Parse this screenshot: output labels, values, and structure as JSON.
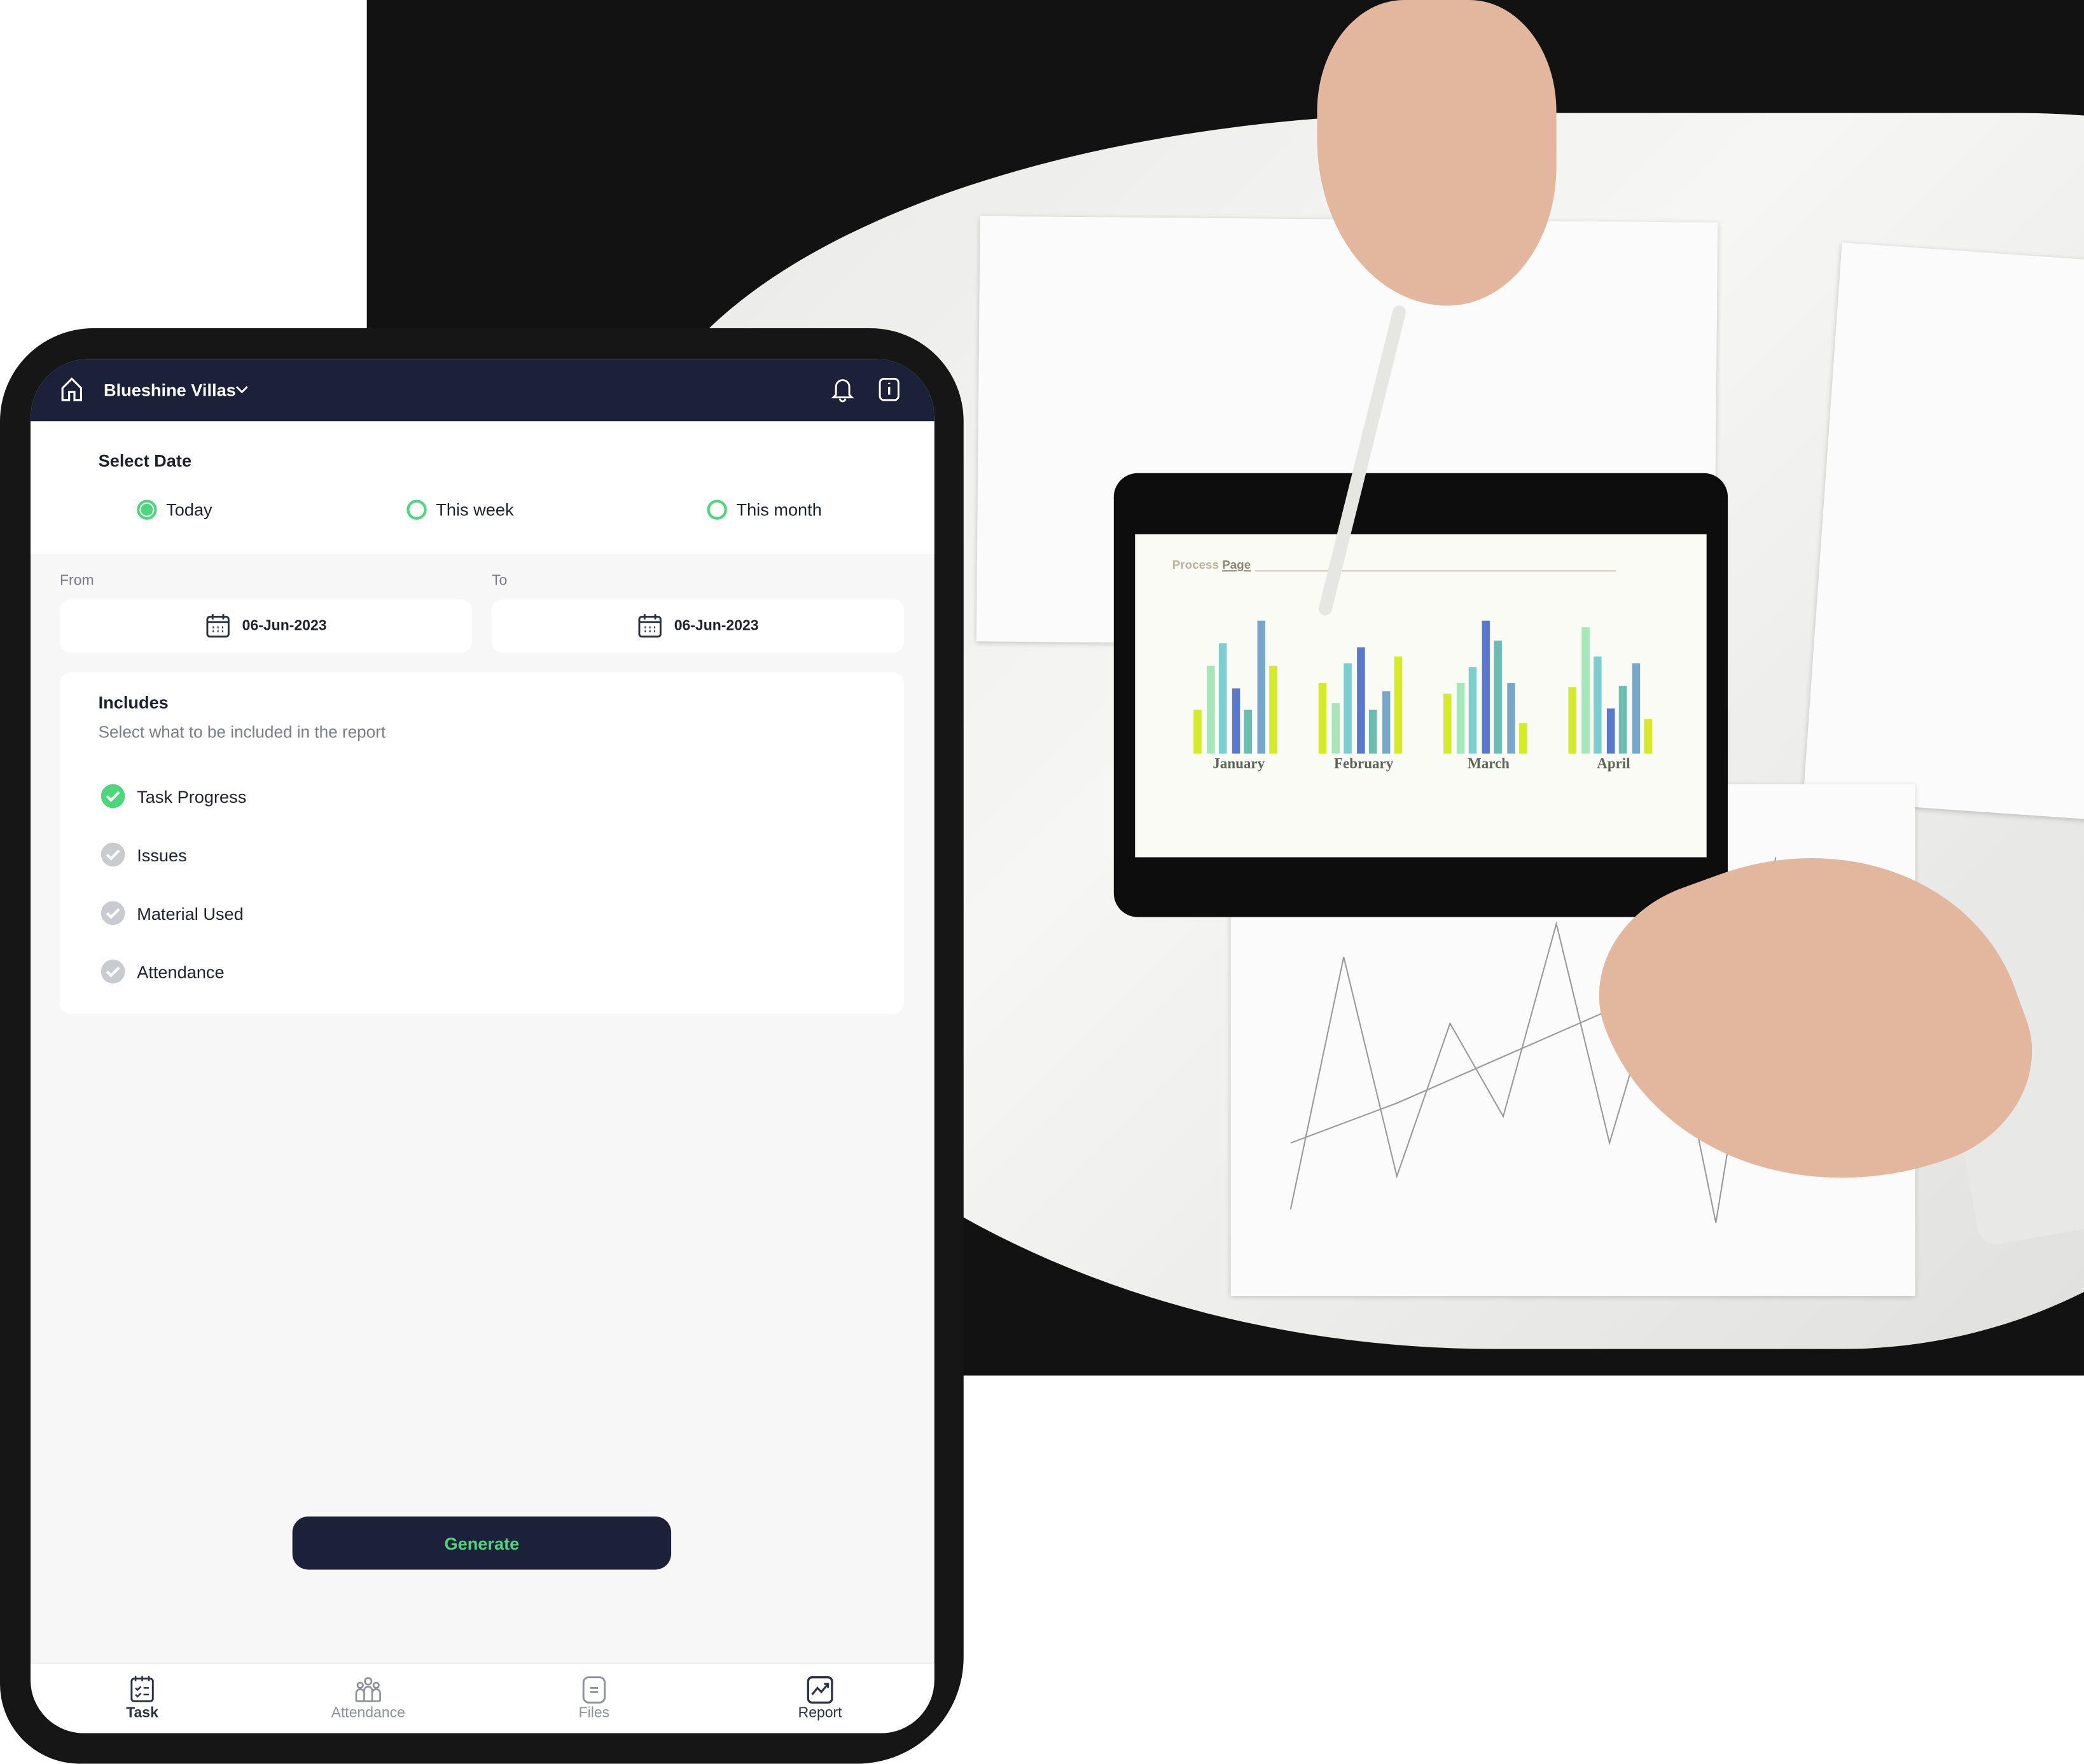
{
  "header": {
    "project": "Blueshine Villas",
    "icons": [
      "home-icon",
      "chevron-down-icon",
      "bell-icon",
      "info-icon"
    ]
  },
  "select_date": {
    "title": "Select Date",
    "options": [
      {
        "label": "Today",
        "selected": true
      },
      {
        "label": "This week",
        "selected": false
      },
      {
        "label": "This month",
        "selected": false
      }
    ]
  },
  "range": {
    "from_label": "From",
    "from_value": "06-Jun-2023",
    "to_label": "To",
    "to_value": "06-Jun-2023"
  },
  "includes": {
    "title": "Includes",
    "subtitle": "Select what to be included in the report",
    "items": [
      {
        "label": "Task Progress",
        "checked": true
      },
      {
        "label": "Issues",
        "checked": false
      },
      {
        "label": "Material Used",
        "checked": false
      },
      {
        "label": "Attendance",
        "checked": false
      }
    ]
  },
  "generate_label": "Generate",
  "nav": [
    {
      "label": "Task",
      "icon": "task-icon",
      "active": false
    },
    {
      "label": "Attendance",
      "icon": "attendance-icon",
      "active": false
    },
    {
      "label": "Files",
      "icon": "files-icon",
      "active": false
    },
    {
      "label": "Report",
      "icon": "report-icon",
      "active": true
    }
  ],
  "colors": {
    "navy": "#1b2139",
    "accent": "#4cd77a",
    "inactive": "#c9cbd0"
  },
  "photo": {
    "tablet_title_a": "Process",
    "tablet_title_b": "Page",
    "months": [
      "January",
      "February",
      "March",
      "April"
    ],
    "bars": [
      [
        33,
        66,
        83,
        49,
        33,
        100,
        66
      ],
      [
        53,
        38,
        68,
        80,
        33,
        47,
        73
      ],
      [
        45,
        53,
        65,
        100,
        85,
        53,
        23
      ],
      [
        50,
        95,
        73,
        34,
        51,
        68,
        26
      ]
    ],
    "bar_colors": [
      "#d4ea2a",
      "#a6e6b8",
      "#7cced0",
      "#5a78cc",
      "#6bbdb0",
      "#79a7c9",
      "#d4ea2a"
    ]
  }
}
